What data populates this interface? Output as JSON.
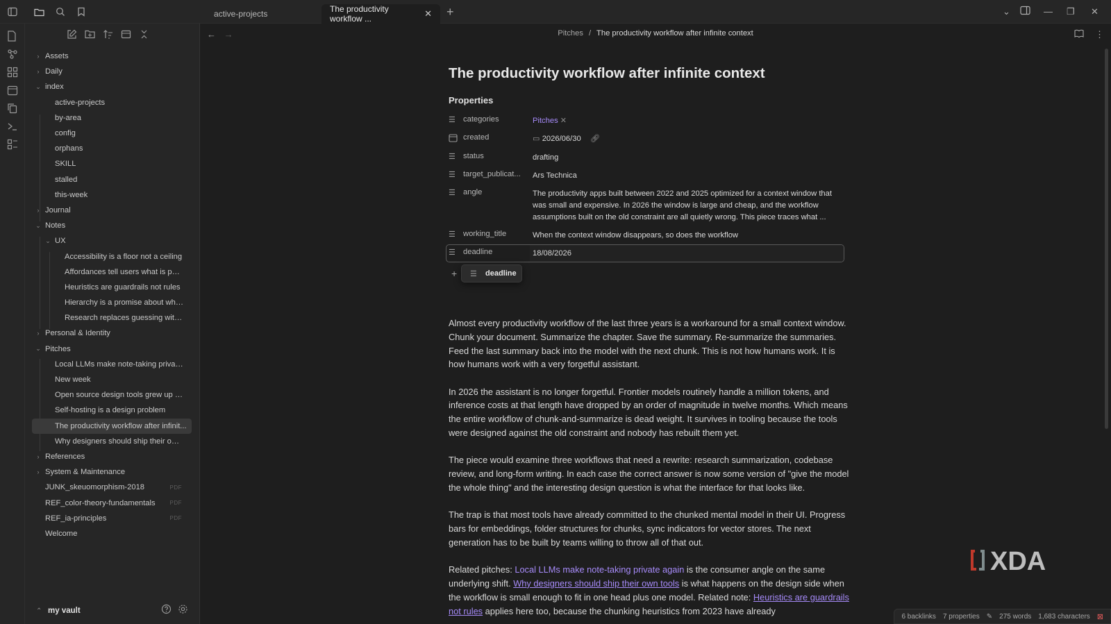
{
  "tabs": [
    {
      "label": "active-projects",
      "active": false
    },
    {
      "label": "The productivity workflow ...",
      "active": true
    }
  ],
  "sidebar": {
    "tree": [
      {
        "label": "Assets",
        "depth": 0,
        "chevron": "right"
      },
      {
        "label": "Daily",
        "depth": 0,
        "chevron": "right"
      },
      {
        "label": "index",
        "depth": 0,
        "chevron": "down"
      },
      {
        "label": "active-projects",
        "depth": 1
      },
      {
        "label": "by-area",
        "depth": 1
      },
      {
        "label": "config",
        "depth": 1
      },
      {
        "label": "orphans",
        "depth": 1
      },
      {
        "label": "SKILL",
        "depth": 1
      },
      {
        "label": "stalled",
        "depth": 1
      },
      {
        "label": "this-week",
        "depth": 1
      },
      {
        "label": "Journal",
        "depth": 0,
        "chevron": "right"
      },
      {
        "label": "Notes",
        "depth": 0,
        "chevron": "down"
      },
      {
        "label": "UX",
        "depth": 1,
        "chevron": "down"
      },
      {
        "label": "Accessibility is a floor not a ceiling",
        "depth": 2
      },
      {
        "label": "Affordances tell users what is possi...",
        "depth": 2
      },
      {
        "label": "Heuristics are guardrails not rules",
        "depth": 2
      },
      {
        "label": "Hierarchy is a promise about what ...",
        "depth": 2
      },
      {
        "label": "Research replaces guessing with wi...",
        "depth": 2
      },
      {
        "label": "Personal & Identity",
        "depth": 0,
        "chevron": "right"
      },
      {
        "label": "Pitches",
        "depth": 0,
        "chevron": "down"
      },
      {
        "label": "Local LLMs make note-taking private ...",
        "depth": 1
      },
      {
        "label": "New week",
        "depth": 1
      },
      {
        "label": "Open source design tools grew up in ...",
        "depth": 1
      },
      {
        "label": "Self-hosting is a design problem",
        "depth": 1
      },
      {
        "label": "The productivity workflow after infinit...",
        "depth": 1,
        "selected": true
      },
      {
        "label": "Why designers should ship their own ...",
        "depth": 1
      },
      {
        "label": "References",
        "depth": 0,
        "chevron": "right"
      },
      {
        "label": "System & Maintenance",
        "depth": 0,
        "chevron": "right"
      },
      {
        "label": "JUNK_skeuomorphism-2018",
        "depth": 0,
        "badge": "PDF"
      },
      {
        "label": "REF_color-theory-fundamentals",
        "depth": 0,
        "badge": "PDF"
      },
      {
        "label": "REF_ia-principles",
        "depth": 0,
        "badge": "PDF"
      },
      {
        "label": "Welcome",
        "depth": 0
      }
    ],
    "vault_name": "my vault"
  },
  "breadcrumb": {
    "parent": "Pitches",
    "separator": "/",
    "current": "The productivity workflow after infinite context"
  },
  "doc": {
    "title": "The productivity workflow after infinite context",
    "properties_heading": "Properties",
    "properties": {
      "categories": {
        "key": "categories",
        "value": "Pitches"
      },
      "created": {
        "key": "created",
        "value": "2026/06/30"
      },
      "status": {
        "key": "status",
        "value": "drafting"
      },
      "target": {
        "key": "target_publicat...",
        "value": "Ars Technica"
      },
      "angle": {
        "key": "angle",
        "value": "The productivity apps built between 2022 and 2025 optimized for a context window that was small and expensive. In 2026 the window is large and cheap, and the workflow assumptions built on the old constraint are all quietly wrong. This piece traces what ..."
      },
      "working_title": {
        "key": "working_title",
        "value": "When the context window disappears, so does the workflow"
      },
      "deadline": {
        "key": "deadline",
        "value": "18/08/2026"
      }
    },
    "suggestion": "deadline",
    "paragraphs": {
      "p1": "Almost every productivity workflow of the last three years is a workaround for a small context window. Chunk your document. Summarize the chapter. Save the summary. Re-summarize the summaries. Feed the last summary back into the model with the next chunk. This is not how humans work. It is how humans work with a very forgetful assistant.",
      "p2": "In 2026 the assistant is no longer forgetful. Frontier models routinely handle a million tokens, and inference costs at that length have dropped by an order of magnitude in twelve months. Which means the entire workflow of chunk-and-summarize is dead weight. It survives in tooling because the tools were designed against the old constraint and nobody has rebuilt them yet.",
      "p3": "The piece would examine three workflows that need a rewrite: research summarization, codebase review, and long-form writing. In each case the correct answer is now some version of \"give the model the whole thing\" and the interesting design question is what the interface for that looks like.",
      "p4": "The trap is that most tools have already committed to the chunked mental model in their UI. Progress bars for embeddings, folder structures for chunks, sync indicators for vector stores. The next generation has to be built by teams willing to throw all of that out.",
      "p5_prefix": "Related pitches: ",
      "p5_link1": "Local LLMs make note-taking private again",
      "p5_mid1": " is the consumer angle on the same underlying shift. ",
      "p5_link2": "Why designers should ship their own tools",
      "p5_mid2": " is what happens on the design side when the workflow is small enough to fit in one head plus one model. Related note: ",
      "p5_link3": "Heuristics are guardrails not rules",
      "p5_suffix": " applies here too, because the chunking heuristics from 2023 have already"
    }
  },
  "status": {
    "backlinks": "6 backlinks",
    "properties": "7 properties",
    "words": "275 words",
    "characters": "1,683 characters"
  },
  "watermark": "XDA",
  "colors": {
    "accent": "#a78bfa",
    "bg": "#1e1e1e",
    "panel": "#262626"
  }
}
